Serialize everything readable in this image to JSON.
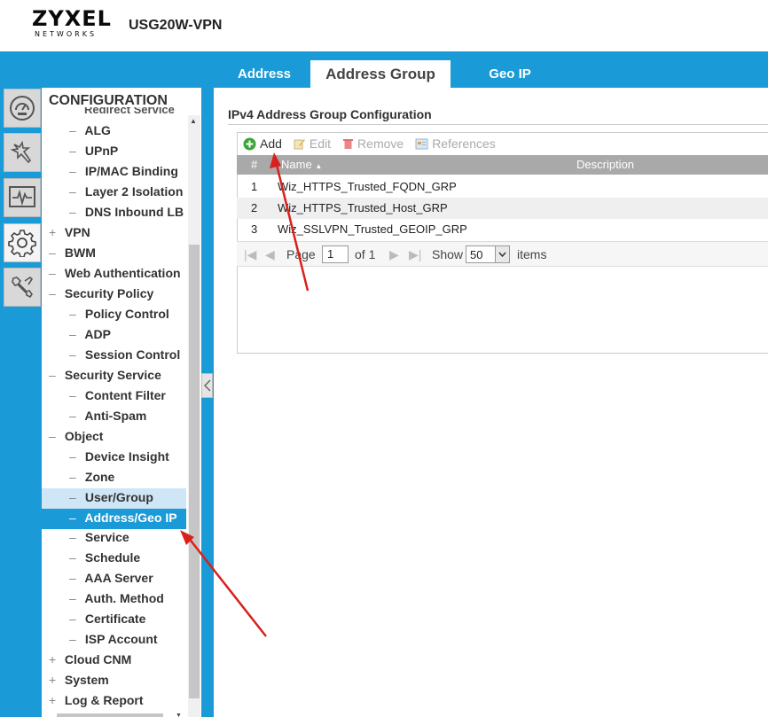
{
  "header": {
    "brand": "ZYXEL",
    "brand_sub": "NETWORKS",
    "model": "USG20W-VPN"
  },
  "tabs": [
    {
      "label": "Address",
      "active": false
    },
    {
      "label": "Address Group",
      "active": true
    },
    {
      "label": "Geo IP",
      "active": false
    }
  ],
  "sidebar_icons": [
    "dashboard-icon",
    "quick-setup-icon",
    "monitor-icon",
    "configuration-icon",
    "maintenance-icon"
  ],
  "nav": {
    "title": "CONFIGURATION",
    "cut_item": "Redirect Service",
    "items": [
      {
        "label": "ALG",
        "prefix": "–",
        "level": 2
      },
      {
        "label": "UPnP",
        "prefix": "–",
        "level": 2
      },
      {
        "label": "IP/MAC Binding",
        "prefix": "–",
        "level": 2
      },
      {
        "label": "Layer 2 Isolation",
        "prefix": "–",
        "level": 2
      },
      {
        "label": "DNS Inbound LB",
        "prefix": "–",
        "level": 2
      },
      {
        "label": "VPN",
        "prefix": "+",
        "level": 1
      },
      {
        "label": "BWM",
        "prefix": "–",
        "level": 1
      },
      {
        "label": "Web Authentication",
        "prefix": "–",
        "level": 1
      },
      {
        "label": "Security Policy",
        "prefix": "–",
        "level": 1
      },
      {
        "label": "Policy Control",
        "prefix": "–",
        "level": 2
      },
      {
        "label": "ADP",
        "prefix": "–",
        "level": 2
      },
      {
        "label": "Session Control",
        "prefix": "–",
        "level": 2
      },
      {
        "label": "Security Service",
        "prefix": "–",
        "level": 1
      },
      {
        "label": "Content Filter",
        "prefix": "–",
        "level": 2
      },
      {
        "label": "Anti-Spam",
        "prefix": "–",
        "level": 2
      },
      {
        "label": "Object",
        "prefix": "–",
        "level": 1
      },
      {
        "label": "Device Insight",
        "prefix": "–",
        "level": 2
      },
      {
        "label": "Zone",
        "prefix": "–",
        "level": 2
      },
      {
        "label": "User/Group",
        "prefix": "–",
        "level": 2,
        "state": "hover"
      },
      {
        "label": "Address/Geo IP",
        "prefix": "–",
        "level": 2,
        "state": "selected"
      },
      {
        "label": "Service",
        "prefix": "–",
        "level": 2
      },
      {
        "label": "Schedule",
        "prefix": "–",
        "level": 2
      },
      {
        "label": "AAA Server",
        "prefix": "–",
        "level": 2
      },
      {
        "label": "Auth. Method",
        "prefix": "–",
        "level": 2
      },
      {
        "label": "Certificate",
        "prefix": "–",
        "level": 2
      },
      {
        "label": "ISP Account",
        "prefix": "–",
        "level": 2
      },
      {
        "label": "Cloud CNM",
        "prefix": "+",
        "level": 1
      },
      {
        "label": "System",
        "prefix": "+",
        "level": 1
      },
      {
        "label": "Log & Report",
        "prefix": "+",
        "level": 1
      }
    ]
  },
  "main": {
    "section_title": "IPv4 Address Group Configuration",
    "toolbar": {
      "add": "Add",
      "edit": "Edit",
      "remove": "Remove",
      "references": "References"
    },
    "table": {
      "columns": [
        "#",
        "Name",
        "Description"
      ],
      "rows": [
        {
          "num": "1",
          "name": "Wiz_HTTPS_Trusted_FQDN_GRP",
          "description": ""
        },
        {
          "num": "2",
          "name": "Wiz_HTTPS_Trusted_Host_GRP",
          "description": ""
        },
        {
          "num": "3",
          "name": "Wiz_SSLVPN_Trusted_GEOIP_GRP",
          "description": ""
        }
      ]
    },
    "pager": {
      "page_label": "Page",
      "page_value": "1",
      "of_label": "of 1",
      "show_label": "Show",
      "show_value": "50",
      "items_label": "items"
    }
  },
  "colors": {
    "accent_blue": "#1a9ad6",
    "annotation_red": "#d9201c",
    "add_green": "#3aa43a",
    "remove_red": "#e07070"
  }
}
